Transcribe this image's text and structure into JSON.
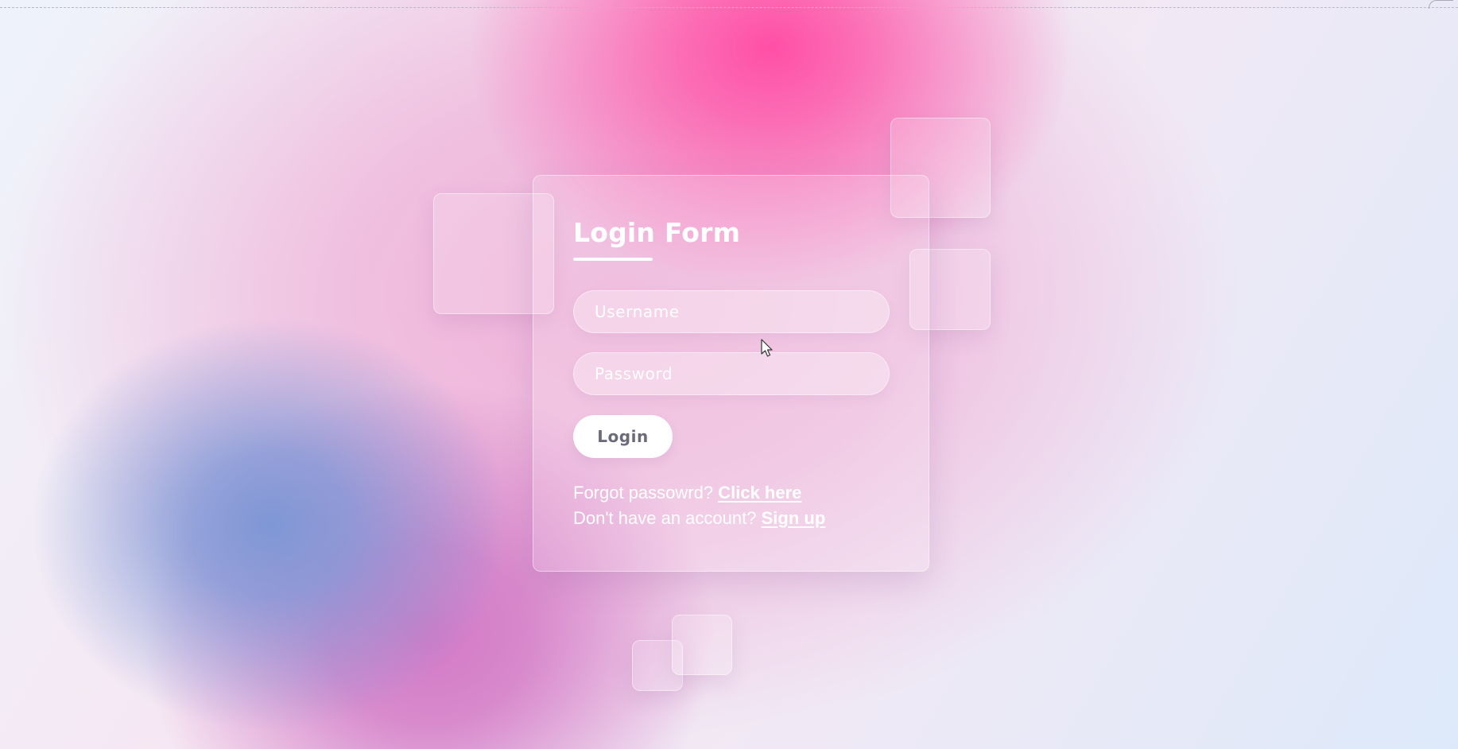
{
  "login_form": {
    "title": "Login Form",
    "username_placeholder": "Username",
    "password_placeholder": "Password",
    "login_button": "Login",
    "forgot_text": "Forgot passowrd?",
    "forgot_link": "Click here",
    "signup_text": "Don't have an account?",
    "signup_link": "Sign up"
  },
  "colors": {
    "accent_pink": "#ff4fa6",
    "accent_blue": "#7f97d6",
    "button_text": "#6b6b7b",
    "text": "#ffffff"
  }
}
